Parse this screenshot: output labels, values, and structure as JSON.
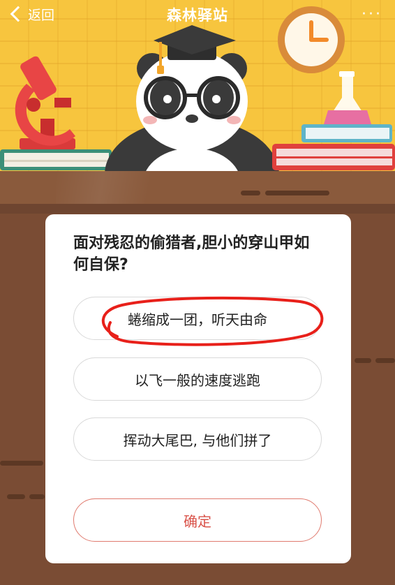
{
  "header": {
    "back_label": "返回",
    "title": "森林驿站",
    "more_label": "···"
  },
  "scene": {
    "icons": [
      "microscope-icon",
      "panda-mascot",
      "graduation-cap-icon",
      "clock-icon",
      "flask-icon",
      "books-icon"
    ]
  },
  "quiz": {
    "question": "面对残忍的偷猎者,胆小的穿山甲如何自保?",
    "options": [
      {
        "label": "蜷缩成一团，听天由命",
        "marked": true
      },
      {
        "label": "以飞一般的速度逃跑",
        "marked": false
      },
      {
        "label": "挥动大尾巴, 与他们拼了",
        "marked": false
      }
    ],
    "confirm_label": "确定"
  },
  "colors": {
    "background_yellow": "#f7c53e",
    "wood": "#7a4c34",
    "confirm_red": "#d9534a",
    "annotation_red": "#e8201a"
  }
}
